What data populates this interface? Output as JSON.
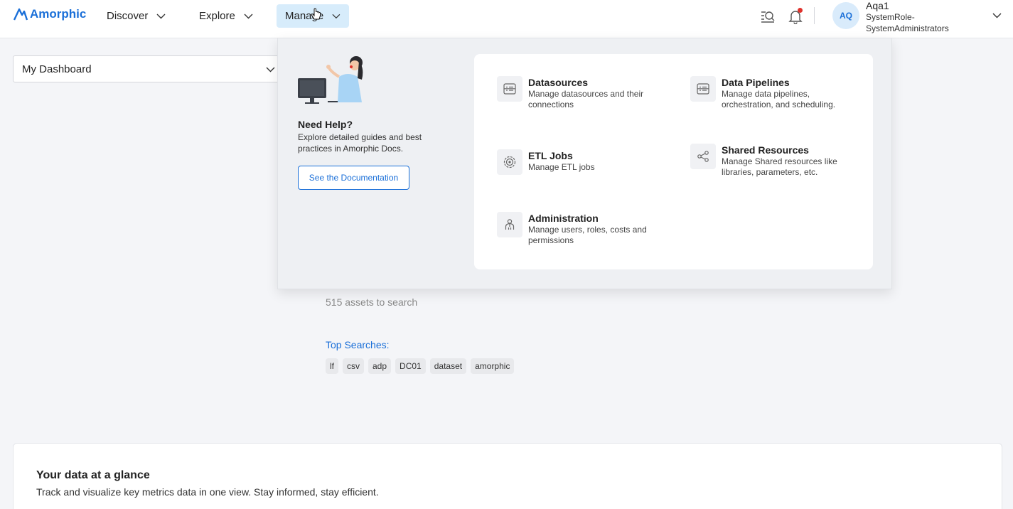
{
  "brand": {
    "name": "Amorphic",
    "color": "#1a6fd8"
  },
  "nav": {
    "discover": "Discover",
    "explore": "Explore",
    "manage": "Manage"
  },
  "header_icons": [
    "search-catalog-icon",
    "bell-icon",
    "chevron-down-icon"
  ],
  "user": {
    "initials": "AQ",
    "name": "Aqa1",
    "role": "SystemRole-SystemAdministrators"
  },
  "dashboard_select": {
    "value": "My Dashboard"
  },
  "search": {
    "assets_count": "515 assets to search",
    "top_searches_label": "Top Searches:",
    "chips": [
      "lf",
      "csv",
      "adp",
      "DC01",
      "dataset",
      "amorphic"
    ]
  },
  "glance": {
    "title": "Your data at a glance",
    "subtitle": "Track and visualize key metrics data in one view. Stay informed, stay efficient."
  },
  "manage_menu": {
    "help": {
      "title": "Need Help?",
      "description": "Explore detailed guides and best practices in Amorphic Docs.",
      "button": "See the Documentation"
    },
    "items": [
      {
        "title": "Datasources",
        "description": "Manage datasources and their connections",
        "icon": "datasource-icon"
      },
      {
        "title": "Data Pipelines",
        "description": "Manage data pipelines, orchestration, and scheduling.",
        "icon": "pipeline-icon"
      },
      {
        "title": "ETL Jobs",
        "description": "Manage ETL jobs",
        "icon": "etl-icon"
      },
      {
        "title": "Shared Resources",
        "description": "Manage Shared resources like libraries, parameters, etc.",
        "icon": "share-icon"
      },
      {
        "title": "Administration",
        "description": "Manage users, roles, costs and permissions",
        "icon": "admin-icon"
      }
    ]
  }
}
